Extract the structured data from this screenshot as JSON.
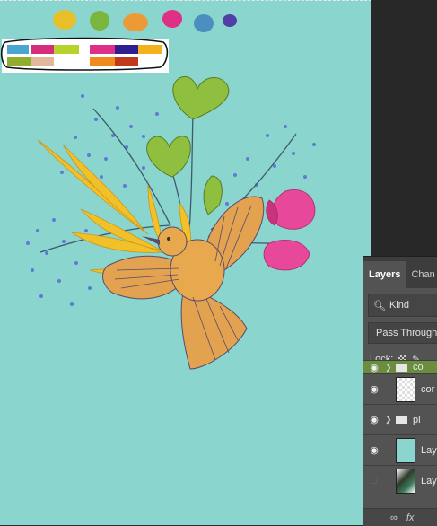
{
  "layers_panel": {
    "tabs": [
      "Layers",
      "Chan"
    ],
    "filter_label": "Kind",
    "blend_mode": "Pass Through",
    "lock_label": "Lock:",
    "layers": [
      {
        "name": "co",
        "type": "group",
        "visible": true,
        "selected": true
      },
      {
        "name": "cor",
        "type": "layer",
        "visible": true,
        "selected": false
      },
      {
        "name": "pl",
        "type": "group",
        "visible": true,
        "selected": false
      },
      {
        "name": "Lay",
        "type": "layer",
        "visible": true,
        "selected": false
      },
      {
        "name": "Lay",
        "type": "layer",
        "visible": false,
        "selected": false
      }
    ],
    "footer_fx": "fx"
  },
  "palette_colors": {
    "blobs": [
      "#e7bf2a",
      "#7ab53e",
      "#eb9a35",
      "#e02f86",
      "#4a8fbf",
      "#4f40a6"
    ],
    "swatches": [
      "#4aa6d1",
      "#d62d7d",
      "#b5d32a",
      "#e02f86",
      "#2d1f8f",
      "#f2b21d",
      "#90ad2e",
      "#e2b89a",
      "#f08a1d",
      "#c23a1e"
    ]
  },
  "colors": {
    "canvas_bg": "#8ad5ce",
    "panel_bg": "#535353",
    "selected_row": "#6a8d3e"
  }
}
